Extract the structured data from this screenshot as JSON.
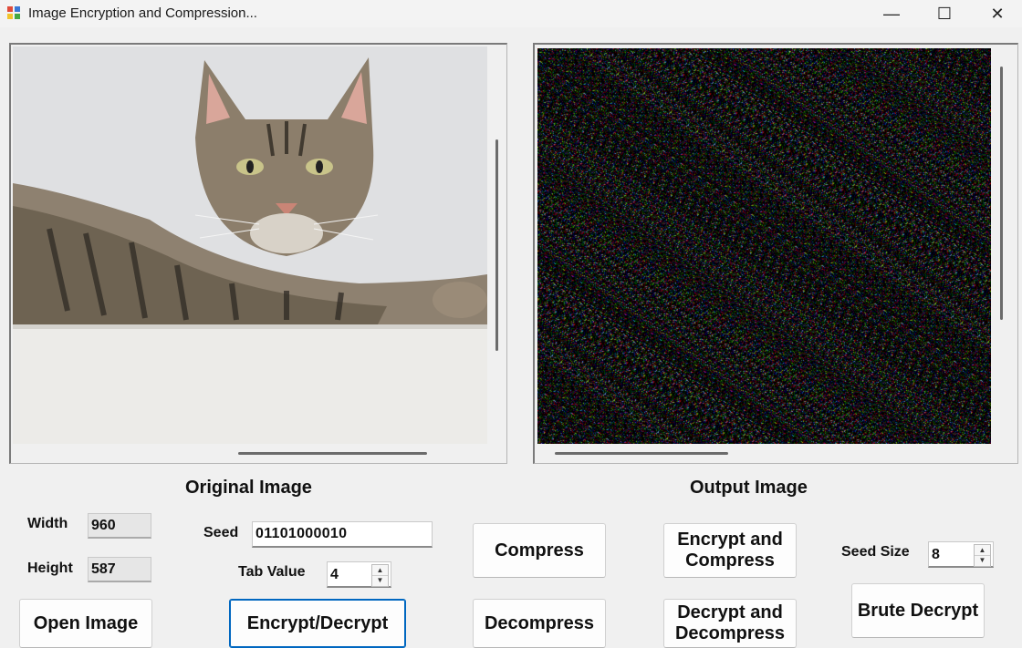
{
  "window": {
    "title": "Image Encryption and Compression...",
    "controls": [
      "—",
      "☐",
      "✕"
    ]
  },
  "panels": {
    "original_label": "Original Image",
    "output_label": "Output Image"
  },
  "fields": {
    "width_label": "Width",
    "width_value": "960",
    "height_label": "Height",
    "height_value": "587",
    "seed_label": "Seed",
    "seed_value": "01101000010",
    "tab_label": "Tab Value",
    "tab_value": "4",
    "seed_size_label": "Seed Size",
    "seed_size_value": "8"
  },
  "buttons": {
    "open_image": "Open Image",
    "encrypt_decrypt": "Encrypt/Decrypt",
    "compress": "Compress",
    "decompress": "Decompress",
    "encrypt_compress": "Encrypt and Compress",
    "decrypt_decompress": "Decrypt and Decompress",
    "brute_decrypt": "Brute Decrypt"
  },
  "icons": {
    "app": "app-icon",
    "photo": "cat-photo",
    "noise": "noise-image"
  }
}
